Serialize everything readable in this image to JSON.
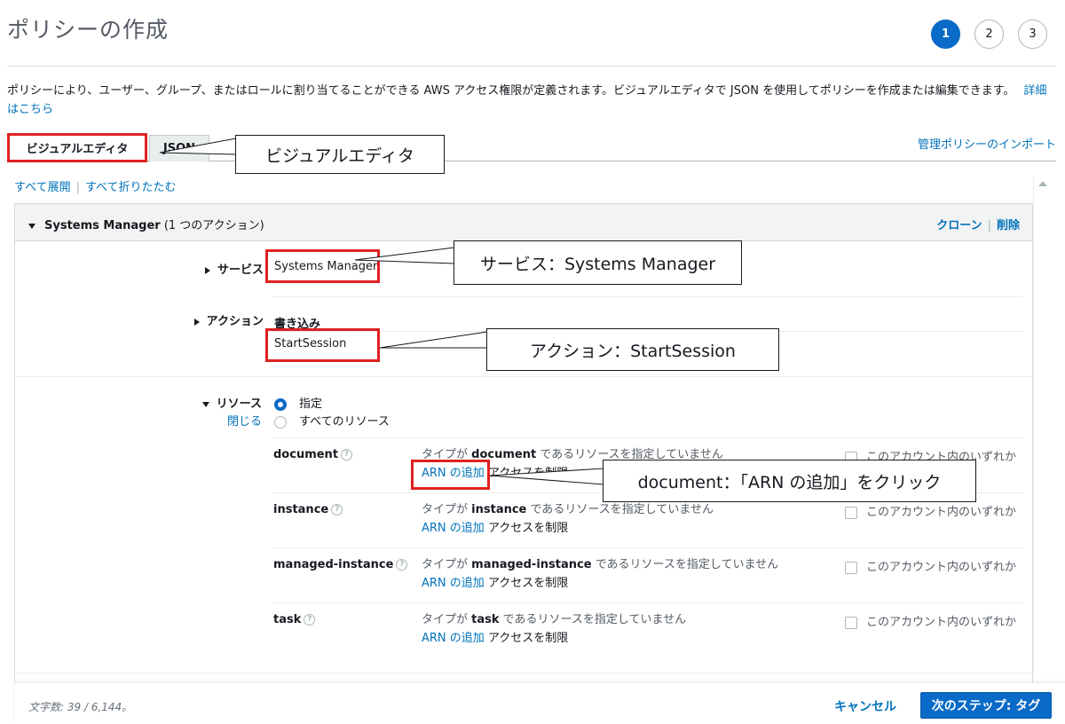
{
  "page": {
    "title": "ポリシーの作成"
  },
  "steps": [
    "1",
    "2",
    "3"
  ],
  "intro": {
    "text": "ポリシーにより、ユーザー、グループ、またはロールに割り当てることができる AWS アクセス権限が定義されます。ビジュアルエディタで JSON を使用してポリシーを作成または編集できます。",
    "link": "詳細はこちら"
  },
  "tabs": {
    "visual": "ビジュアルエディタ",
    "json": "JSON",
    "import": "管理ポリシーのインポート"
  },
  "expand": {
    "expand_all": "すべて展開",
    "collapse_all": "すべて折りたたむ"
  },
  "panel": {
    "service_name": "Systems Manager",
    "action_count": "(1 つのアクション)",
    "clone": "クローン",
    "delete": "削除"
  },
  "service": {
    "label": "サービス",
    "value": "Systems Manager"
  },
  "action": {
    "label": "アクション",
    "group": "書き込み",
    "value": "StartSession"
  },
  "resources": {
    "label": "リソース",
    "close": "閉じる",
    "option_specific": "指定",
    "option_all": "すべてのリソース",
    "add_arn": "ARN の追加",
    "restrict": "アクセスを制限",
    "any_in_account": "このアカウント内のいずれか",
    "desc_prefix": "タイプが",
    "desc_suffix": "であるリソースを指定していません",
    "help_glyph": "?",
    "items": [
      {
        "name": "document"
      },
      {
        "name": "instance"
      },
      {
        "name": "managed-instance"
      },
      {
        "name": "task"
      }
    ]
  },
  "callouts": {
    "visual_editor": "ビジュアルエディタ",
    "service": "サービス：Systems Manager",
    "action": "アクション：StartSession",
    "document": "document：「ARN の追加」をクリック"
  },
  "footer": {
    "char_count": "文字数: 39 / 6,144。",
    "cancel": "キャンセル",
    "next": "次のステップ: タグ"
  }
}
